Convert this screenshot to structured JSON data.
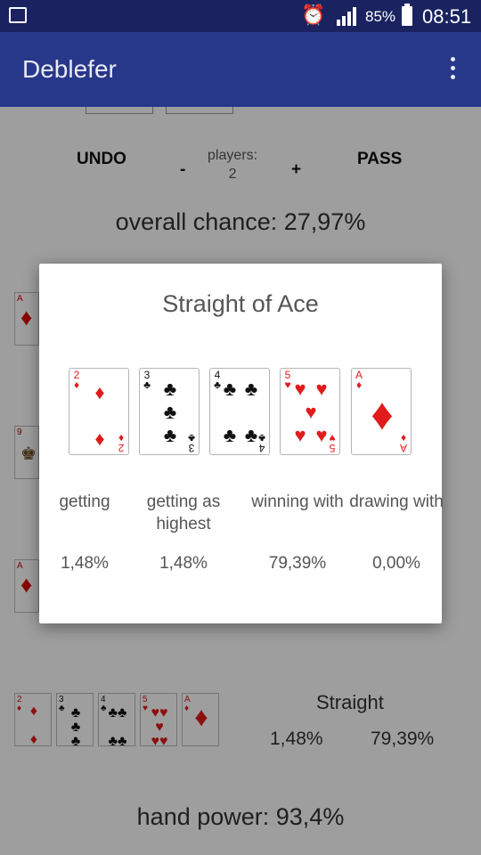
{
  "status": {
    "battery": "85%",
    "time": "08:51",
    "icons": [
      "image-icon",
      "alarm-icon",
      "signal-icon",
      "battery-icon"
    ]
  },
  "appbar": {
    "title": "Deblefer",
    "menu_icon": "overflow-menu-icon"
  },
  "controls": {
    "undo": "UNDO",
    "minus": "-",
    "players_label": "players:",
    "players_value": "2",
    "plus": "+",
    "pass": "PASS",
    "partial_card_value": "6"
  },
  "overall": "overall chance: 27,97%",
  "hand": {
    "name": "Straight",
    "getting": "1,48%",
    "winning": "79,39%"
  },
  "hand_power": "hand power: 93,4%",
  "dialog": {
    "title": "Straight of Ace",
    "cards": [
      {
        "rank": "2",
        "suit": "♦",
        "color": "#e01b1b"
      },
      {
        "rank": "3",
        "suit": "♣",
        "color": "#111111"
      },
      {
        "rank": "4",
        "suit": "♣",
        "color": "#111111"
      },
      {
        "rank": "5",
        "suit": "♥",
        "color": "#e01b1b"
      },
      {
        "rank": "A",
        "suit": "♦",
        "color": "#e01b1b"
      }
    ],
    "stats": [
      {
        "label": "getting",
        "value": "1,48%"
      },
      {
        "label": "getting as highest",
        "value": "1,48%"
      },
      {
        "label": "winning with",
        "value": "79,39%"
      },
      {
        "label": "drawing with",
        "value": "0,00%"
      }
    ]
  }
}
